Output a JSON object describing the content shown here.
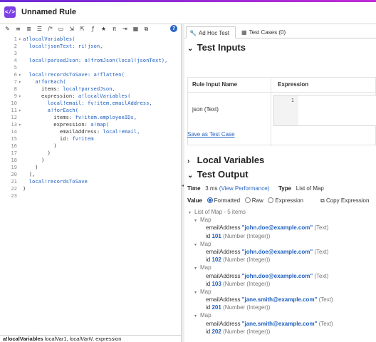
{
  "app": {
    "title": "Unnamed Rule",
    "logo_text": "</>"
  },
  "editor": {
    "toolbar_icons": [
      "format-icon",
      "comment-icon",
      "uncomment-icon",
      "indent-icon",
      "comment-block-icon",
      "code-block-icon",
      "expand-icon",
      "collapse-icon",
      "function-icon",
      "favorite-icon",
      "pi-icon",
      "export-icon",
      "grid-icon",
      "preview-icon"
    ],
    "help_label": "?",
    "lines": [
      {
        "n": "1",
        "fold": "▾",
        "parts": [
          [
            "fn",
            "a!localVariables("
          ]
        ]
      },
      {
        "n": "2",
        "fold": "",
        "parts": [
          [
            "pl",
            "  "
          ],
          [
            "vr",
            "local!jsonText: ri!json,"
          ]
        ]
      },
      {
        "n": "3",
        "fold": "",
        "parts": []
      },
      {
        "n": "4",
        "fold": "",
        "parts": [
          [
            "pl",
            "  "
          ],
          [
            "vr",
            "local!parsedJson: "
          ],
          [
            "fn",
            "a!fromJson(local!jsonText),"
          ]
        ]
      },
      {
        "n": "5",
        "fold": "",
        "parts": []
      },
      {
        "n": "6",
        "fold": "▾",
        "parts": [
          [
            "pl",
            "  "
          ],
          [
            "vr",
            "local!recordsToSave: "
          ],
          [
            "fn",
            "a!flatten("
          ]
        ]
      },
      {
        "n": "7",
        "fold": "▾",
        "parts": [
          [
            "pl",
            "    "
          ],
          [
            "fn",
            "a!forEach("
          ]
        ]
      },
      {
        "n": "8",
        "fold": "",
        "parts": [
          [
            "pl",
            "      items: "
          ],
          [
            "vr",
            "local!parsedJson,"
          ]
        ]
      },
      {
        "n": "9",
        "fold": "▾",
        "parts": [
          [
            "pl",
            "      expression: "
          ],
          [
            "fn",
            "a!localVariables("
          ]
        ]
      },
      {
        "n": "10",
        "fold": "",
        "parts": [
          [
            "pl",
            "        "
          ],
          [
            "vr",
            "local!email: fv!item.emailAddress,"
          ]
        ]
      },
      {
        "n": "11",
        "fold": "▾",
        "parts": [
          [
            "pl",
            "        "
          ],
          [
            "fn",
            "a!forEach("
          ]
        ]
      },
      {
        "n": "12",
        "fold": "",
        "parts": [
          [
            "pl",
            "          items: "
          ],
          [
            "vr",
            "fv!item.employeeIDs,"
          ]
        ]
      },
      {
        "n": "13",
        "fold": "▾",
        "parts": [
          [
            "pl",
            "          expression: "
          ],
          [
            "fn",
            "a!map("
          ]
        ]
      },
      {
        "n": "14",
        "fold": "",
        "parts": [
          [
            "pl",
            "            emailAddress: "
          ],
          [
            "vr",
            "local!email,"
          ]
        ]
      },
      {
        "n": "15",
        "fold": "",
        "parts": [
          [
            "pl",
            "            id: "
          ],
          [
            "vr",
            "fv!item"
          ]
        ]
      },
      {
        "n": "16",
        "fold": "",
        "parts": [
          [
            "pl",
            "          )"
          ]
        ]
      },
      {
        "n": "17",
        "fold": "",
        "parts": [
          [
            "pl",
            "        )"
          ]
        ]
      },
      {
        "n": "18",
        "fold": "",
        "parts": [
          [
            "pl",
            "      )"
          ]
        ]
      },
      {
        "n": "19",
        "fold": "",
        "parts": [
          [
            "pl",
            "    )"
          ]
        ]
      },
      {
        "n": "20",
        "fold": "",
        "parts": [
          [
            "pl",
            "  ),"
          ]
        ]
      },
      {
        "n": "21",
        "fold": "",
        "parts": [
          [
            "pl",
            "  "
          ],
          [
            "vr",
            "local!recordsToSave"
          ]
        ]
      },
      {
        "n": "22",
        "fold": "",
        "parts": [
          [
            "pl",
            ")"
          ]
        ]
      },
      {
        "n": "23",
        "fold": "",
        "parts": []
      }
    ],
    "status": {
      "fn": "a!localVariables",
      "args": "localVar1, ",
      "args_italic": "localVarN",
      "args_end": ", expression"
    }
  },
  "tabs": [
    {
      "label": "Ad Hoc Test",
      "icon": "wrench-icon"
    },
    {
      "label": "Test Cases (0)",
      "icon": "table-icon"
    }
  ],
  "test_inputs": {
    "heading": "Test Inputs",
    "col_input": "Rule Input Name",
    "col_expr": "Expression",
    "input_name": "json (Text)",
    "expr_line": "1",
    "save_link": "Save as Test Case"
  },
  "local_variables": {
    "heading": "Local Variables"
  },
  "test_output": {
    "heading": "Test Output",
    "time_label": "Time",
    "time_value": "3 ms",
    "view_perf": "(View Performance)",
    "type_label": "Type",
    "type_value": "List of Map",
    "value_label": "Value",
    "radio_formatted": "Formatted",
    "radio_raw": "Raw",
    "radio_expression": "Expression",
    "copy_expression": "Copy Expression",
    "list_header": "List of Map - 5 items",
    "map_label": "Map",
    "email_key": "emailAddress",
    "id_key": "id",
    "text_type": "(Text)",
    "num_type": "(Number (Integer))",
    "items": [
      {
        "email": "\"john.doe@example.com\"",
        "id": "101"
      },
      {
        "email": "\"john.doe@example.com\"",
        "id": "102"
      },
      {
        "email": "\"john.doe@example.com\"",
        "id": "103"
      },
      {
        "email": "\"jane.smith@example.com\"",
        "id": "201"
      },
      {
        "email": "\"jane.smith@example.com\"",
        "id": "202"
      }
    ]
  }
}
